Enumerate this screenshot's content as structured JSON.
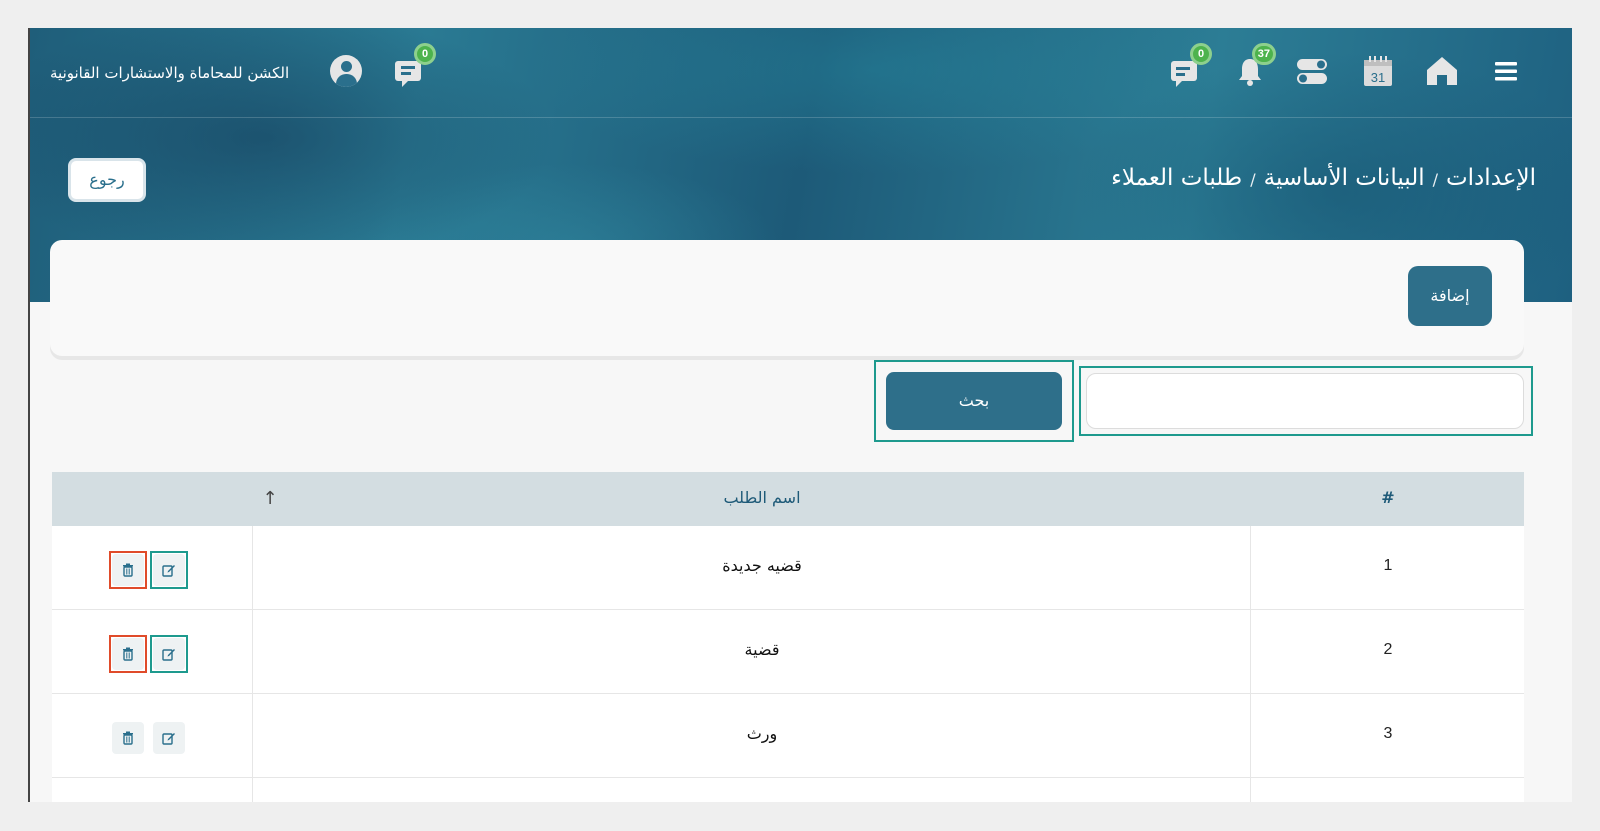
{
  "header": {
    "brand": "الكشن للمحاماة والاستشارات القانونية",
    "messages_badge": "0",
    "chat_badge": "0",
    "notifications_badge": "37",
    "calendar_day": "31"
  },
  "breadcrumb": {
    "items": [
      "الإعدادات",
      "البيانات الأساسية",
      "طلبات العملاء"
    ],
    "separator": "/"
  },
  "back_label": "رجوع",
  "add_label": "إضافة",
  "search": {
    "value": "",
    "placeholder": "",
    "button_label": "بحث"
  },
  "table": {
    "columns": {
      "index": "#",
      "name": "اسم الطلب"
    },
    "rows": [
      {
        "num": "1",
        "name": "قضيه جديدة"
      },
      {
        "num": "2",
        "name": "قضية"
      },
      {
        "num": "3",
        "name": "ورث"
      },
      {
        "num": "",
        "name": ""
      }
    ]
  },
  "colors": {
    "primary": "#2e6f8a",
    "badge": "#4db34d",
    "outline_teal": "#1e9a8e",
    "outline_red": "#e04b2a"
  },
  "icons": [
    "menu-icon",
    "home-icon",
    "calendar-icon",
    "toggle-icon",
    "bell-icon",
    "chat-icon",
    "messages-icon",
    "user-avatar-icon",
    "sort-up-icon",
    "edit-icon",
    "trash-icon"
  ]
}
